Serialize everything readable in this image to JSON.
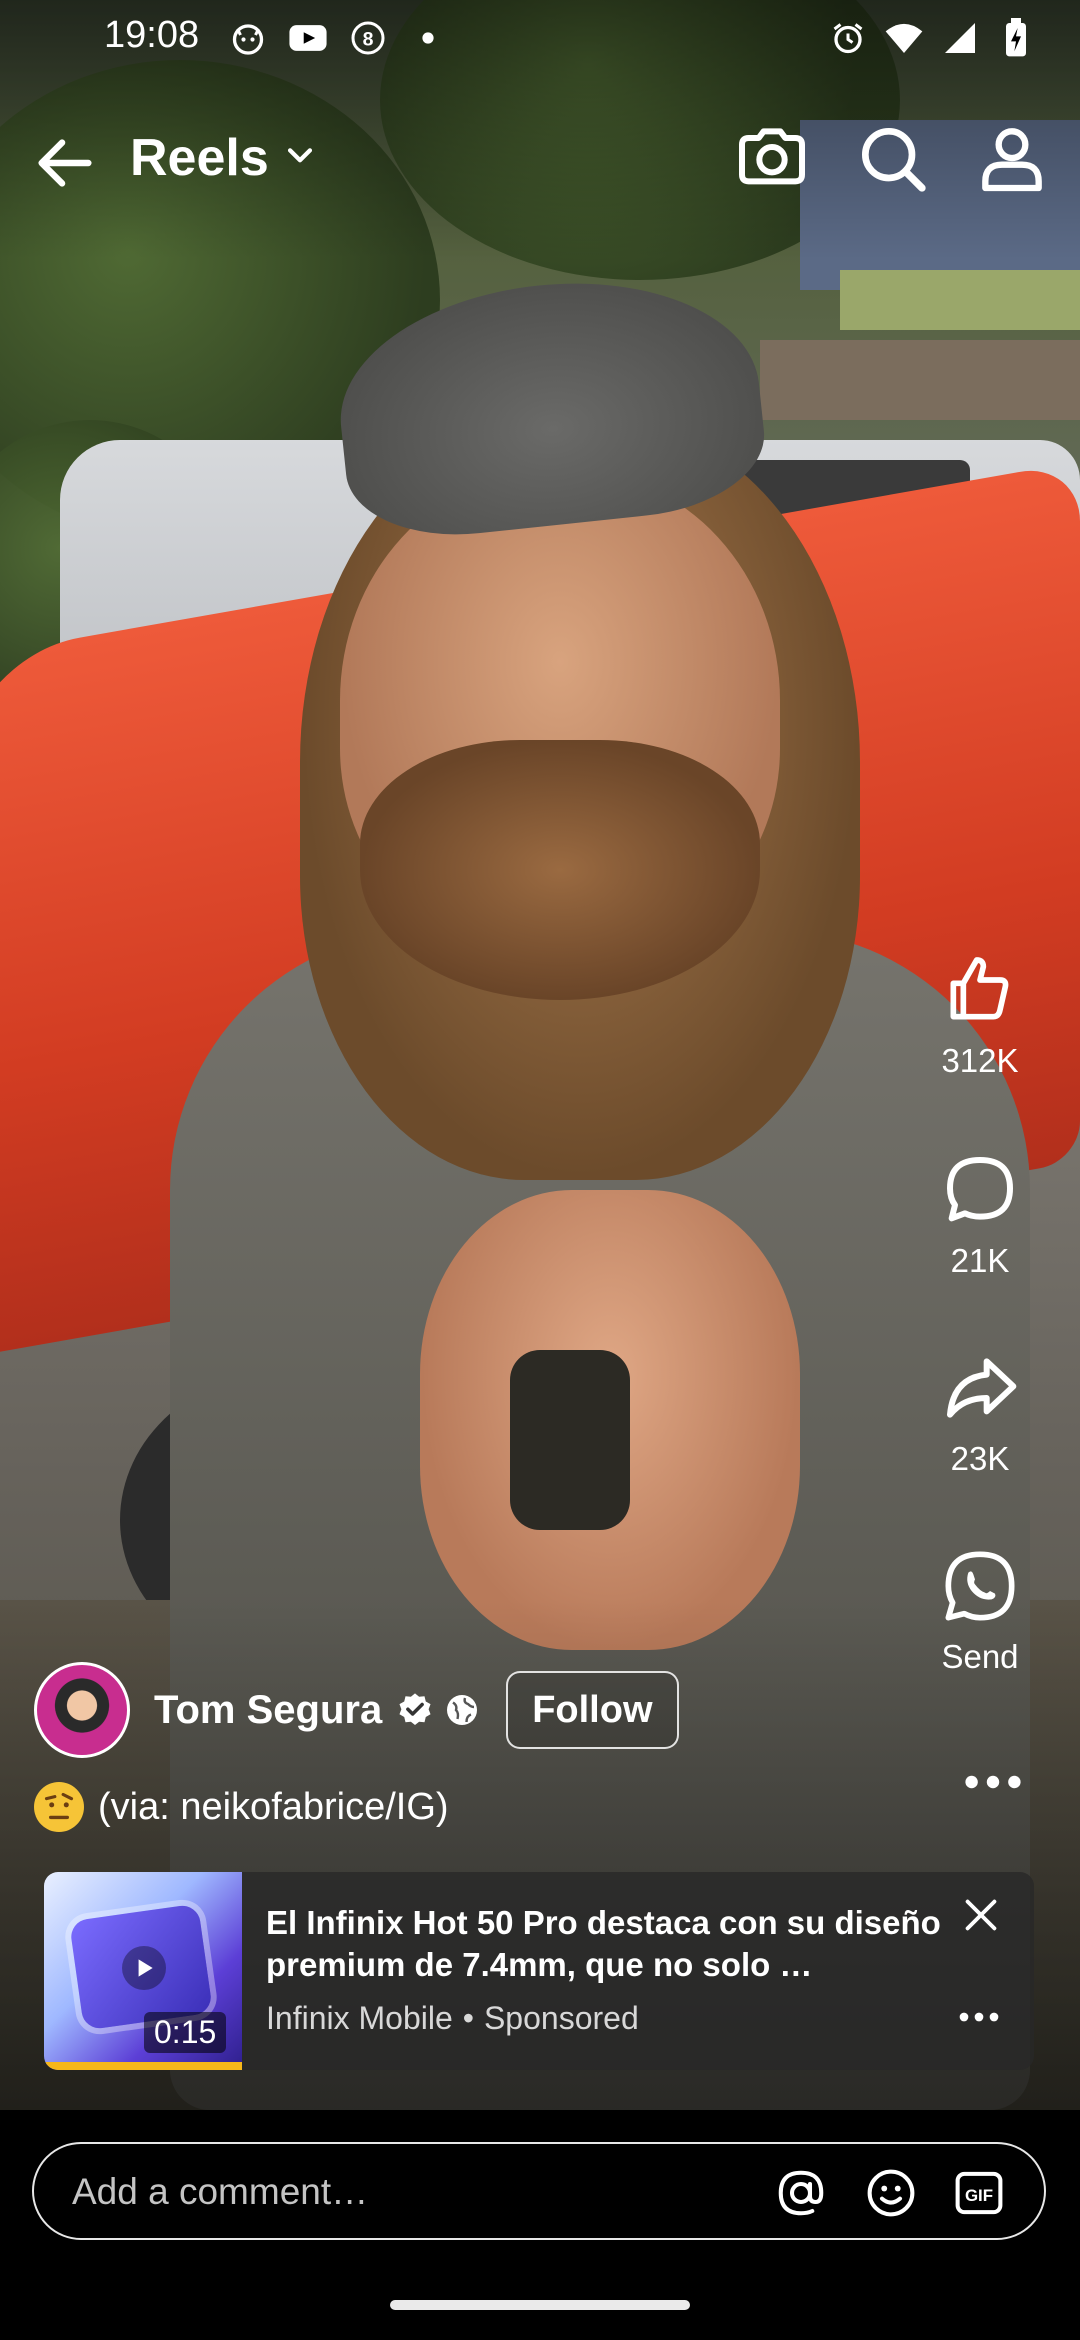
{
  "status_bar": {
    "time": "19:08",
    "left_icons": [
      "cat-face-icon",
      "youtube-icon",
      "circled-8-icon",
      "dot-icon"
    ],
    "right_icons": [
      "alarm-icon",
      "wifi-icon",
      "signal-icon",
      "battery-charging-icon"
    ]
  },
  "header": {
    "title": "Reels",
    "icons": [
      "back-arrow-icon",
      "chevron-down-icon",
      "camera-icon",
      "search-icon",
      "profile-icon"
    ]
  },
  "actions": [
    {
      "name": "like",
      "icon": "thumbs-up-icon",
      "count": "312K"
    },
    {
      "name": "comment",
      "icon": "comment-bubble-icon",
      "count": "21K"
    },
    {
      "name": "share",
      "icon": "share-arrow-icon",
      "count": "23K"
    },
    {
      "name": "send",
      "icon": "whatsapp-icon",
      "count": "Send"
    }
  ],
  "post": {
    "author": "Tom Segura",
    "follow_label": "Follow",
    "caption": "(via: neikofabrice/IG)"
  },
  "ad": {
    "title": "El Infinix Hot 50 Pro destaca con su diseño premium de 7.4mm, que no solo …",
    "advertiser": "Infinix Mobile",
    "separator": "•",
    "sponsored": "Sponsored",
    "duration": "0:15",
    "progress": 1.0
  },
  "comment_bar": {
    "placeholder": "Add a comment…"
  },
  "colors": {
    "background": "#000000",
    "text": "#ffffff",
    "ad_progress": "#f6b71a",
    "avatar_ring": "#c82d8f"
  }
}
